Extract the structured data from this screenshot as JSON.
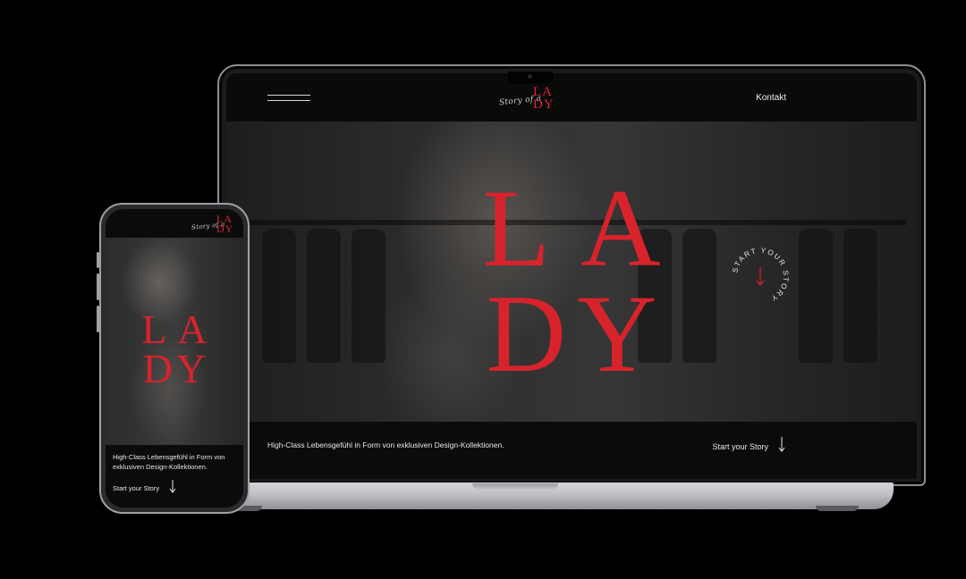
{
  "site": {
    "logo_script": "Story of a",
    "logo_mark_line1": "LA",
    "logo_mark_line2": "DY",
    "nav_contact": "Kontakt",
    "hero_line1": "LA",
    "hero_line2": "DY",
    "badge_text": "START YOUR STORY",
    "tagline": "High-Class Lebensgefühl in Form von exklusiven Design-Kollektionen.",
    "cta_label": "Start your Story"
  },
  "colors": {
    "accent": "#d8232c",
    "background": "#000000",
    "text": "#e8e8e8"
  },
  "icons": {
    "menu": "hamburger-icon",
    "cta": "arrow-down-icon",
    "badge": "arrow-down-icon"
  }
}
